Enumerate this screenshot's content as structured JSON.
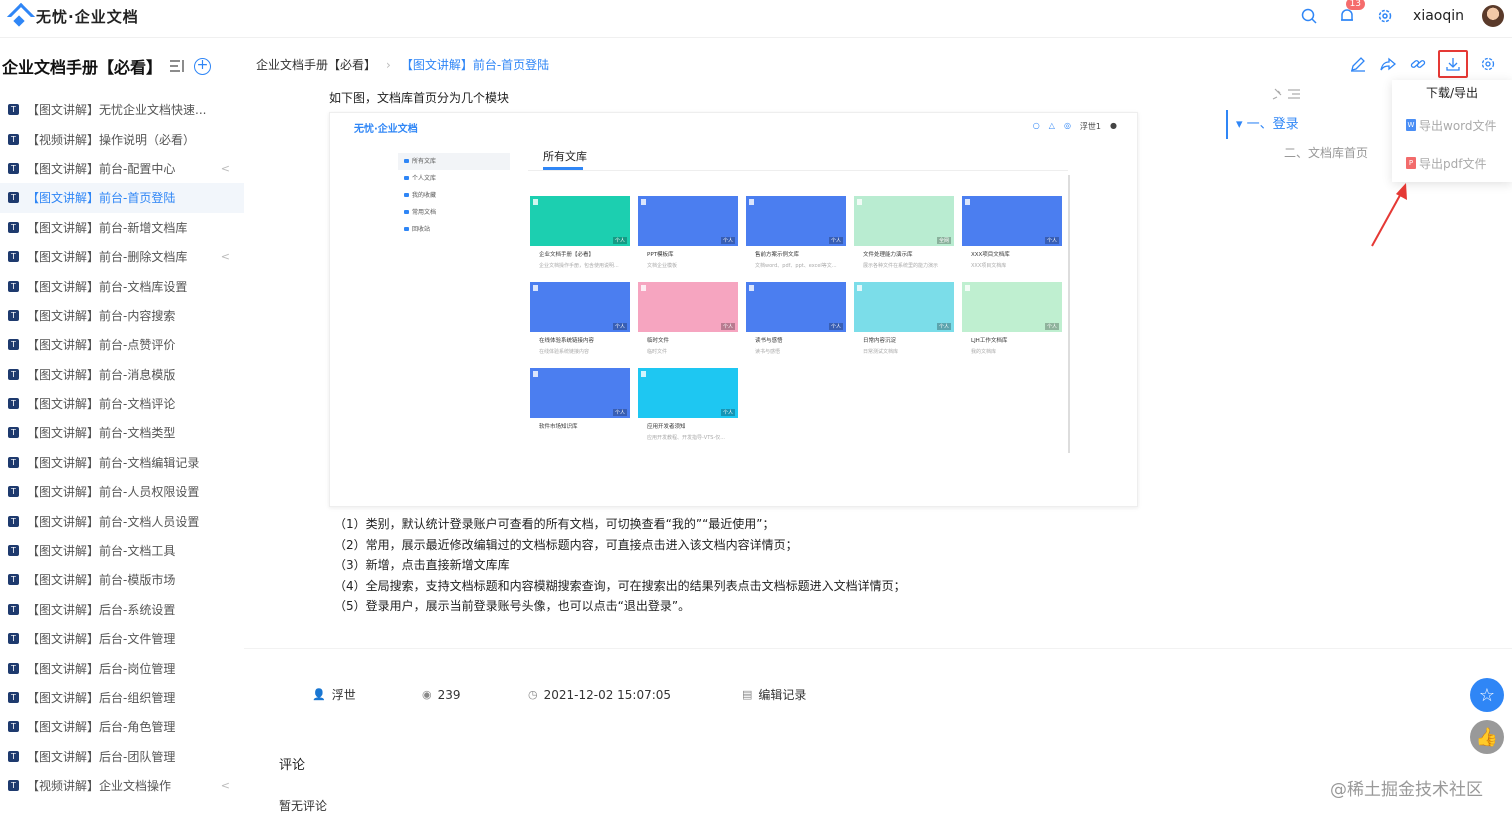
{
  "app": {
    "name": "无忧·企业文档"
  },
  "topbar": {
    "badge": "13",
    "username": "xiaoqin"
  },
  "sidebar": {
    "title": "企业文档手册【必看】",
    "items": [
      {
        "label": "【图文讲解】无忧企业文档快速..."
      },
      {
        "label": "【视频讲解】操作说明（必看）"
      },
      {
        "label": "【图文讲解】前台-配置中心"
      },
      {
        "label": "【图文讲解】前台-首页登陆"
      },
      {
        "label": "【图文讲解】前台-新增文档库"
      },
      {
        "label": "【图文讲解】前台-删除文档库"
      },
      {
        "label": "【图文讲解】前台-文档库设置"
      },
      {
        "label": "【图文讲解】前台-内容搜索"
      },
      {
        "label": "【图文讲解】前台-点赞评价"
      },
      {
        "label": "【图文讲解】前台-消息模版"
      },
      {
        "label": "【图文讲解】前台-文档评论"
      },
      {
        "label": "【图文讲解】前台-文档类型"
      },
      {
        "label": "【图文讲解】前台-文档编辑记录"
      },
      {
        "label": "【图文讲解】前台-人员权限设置"
      },
      {
        "label": "【图文讲解】前台-文档人员设置"
      },
      {
        "label": "【图文讲解】前台-文档工具"
      },
      {
        "label": "【图文讲解】前台-模版市场"
      },
      {
        "label": "【图文讲解】后台-系统设置"
      },
      {
        "label": "【图文讲解】后台-文件管理"
      },
      {
        "label": "【图文讲解】后台-岗位管理"
      },
      {
        "label": "【图文讲解】后台-组织管理"
      },
      {
        "label": "【图文讲解】后台-角色管理"
      },
      {
        "label": "【图文讲解】后台-团队管理"
      },
      {
        "label": "【视频讲解】企业文档操作"
      }
    ]
  },
  "breadcrumb": {
    "root": "企业文档手册【必看】",
    "sep": "›",
    "current": "【图文讲解】前台-首页登陆"
  },
  "dropdown": {
    "title": "下载/导出",
    "word": "导出word文件",
    "pdf": "导出pdf文件"
  },
  "toc": {
    "items": [
      {
        "label": "一、登录"
      },
      {
        "label": "二、文档库首页"
      }
    ]
  },
  "content": {
    "intro": "如下图，文档库首页分为几个模块",
    "embedded": {
      "logo": "无忧·企业文档",
      "user": "浮世1",
      "tab": "所有文库",
      "nav": [
        "所有文库",
        "个人文库",
        "我的收藏",
        "常用文档",
        "回收站"
      ],
      "cards": [
        {
          "name": "企业文档手册【必看】",
          "desc": "企业文档操作手册，包含使用说明...",
          "tag": "个人",
          "color": "#1ccfb0"
        },
        {
          "name": "PPT模板库",
          "desc": "文档企业模板",
          "tag": "个人",
          "color": "#4b7ef0"
        },
        {
          "name": "售前方案示例文库",
          "desc": "文档word、pdf、ppt、excel等文...",
          "tag": "个人",
          "color": "#4b7ef0"
        },
        {
          "name": "文件处理能力演示库",
          "desc": "展示各种文件在系统里的能力演示",
          "tag": "全网",
          "color": "#b9ecd1"
        },
        {
          "name": "XXX项目文档库",
          "desc": "XXX项目文档库",
          "tag": "个人",
          "color": "#4b7ef0"
        },
        {
          "name": "在线体验系统链接内容",
          "desc": "在线体验系统链接内容",
          "tag": "个人",
          "color": "#4b7ef0"
        },
        {
          "name": "临时文件",
          "desc": "临时文件",
          "tag": "个人",
          "color": "#f6a5c0"
        },
        {
          "name": "读书与感悟",
          "desc": "读书与感悟",
          "tag": "个人",
          "color": "#4b7ef0"
        },
        {
          "name": "日常内容沉淀",
          "desc": "日常测试文档库",
          "tag": "个人",
          "color": "#7bdde9"
        },
        {
          "name": "LJH工作文档库",
          "desc": "我的文档库",
          "tag": "个人",
          "color": "#bfefd0"
        },
        {
          "name": "软件市场知识库",
          "desc": "",
          "tag": "个人",
          "color": "#4b7ef0"
        },
        {
          "name": "应用开发者须知",
          "desc": "应用开发教程、开发指导-VTS-仅...",
          "tag": "个人",
          "color": "#1ec7f2"
        }
      ]
    },
    "notes": [
      "（1）类别，默认统计登录账户可查看的所有文档，可切换查看“我的”“最近使用”；",
      "（2）常用，展示最近修改编辑过的文档标题内容，可直接点击进入该文档内容详情页；",
      "（3）新增，点击直接新增文库库",
      "（4）全局搜索，支持文档标题和内容模糊搜索查询，可在搜索出的结果列表点击文档标题进入文档详情页；",
      "（5）登录用户，展示当前登录账号头像，也可以点击“退出登录”。"
    ]
  },
  "meta": {
    "author": "浮世",
    "views": "239",
    "time": "2021-12-02 15:07:05",
    "history": "编辑记录"
  },
  "comments": {
    "title": "评论",
    "empty": "暂无评论"
  },
  "watermark": "@稀土掘金技术社区",
  "colors": {
    "accent": "#2f86f6",
    "highlight": "#e53935"
  }
}
